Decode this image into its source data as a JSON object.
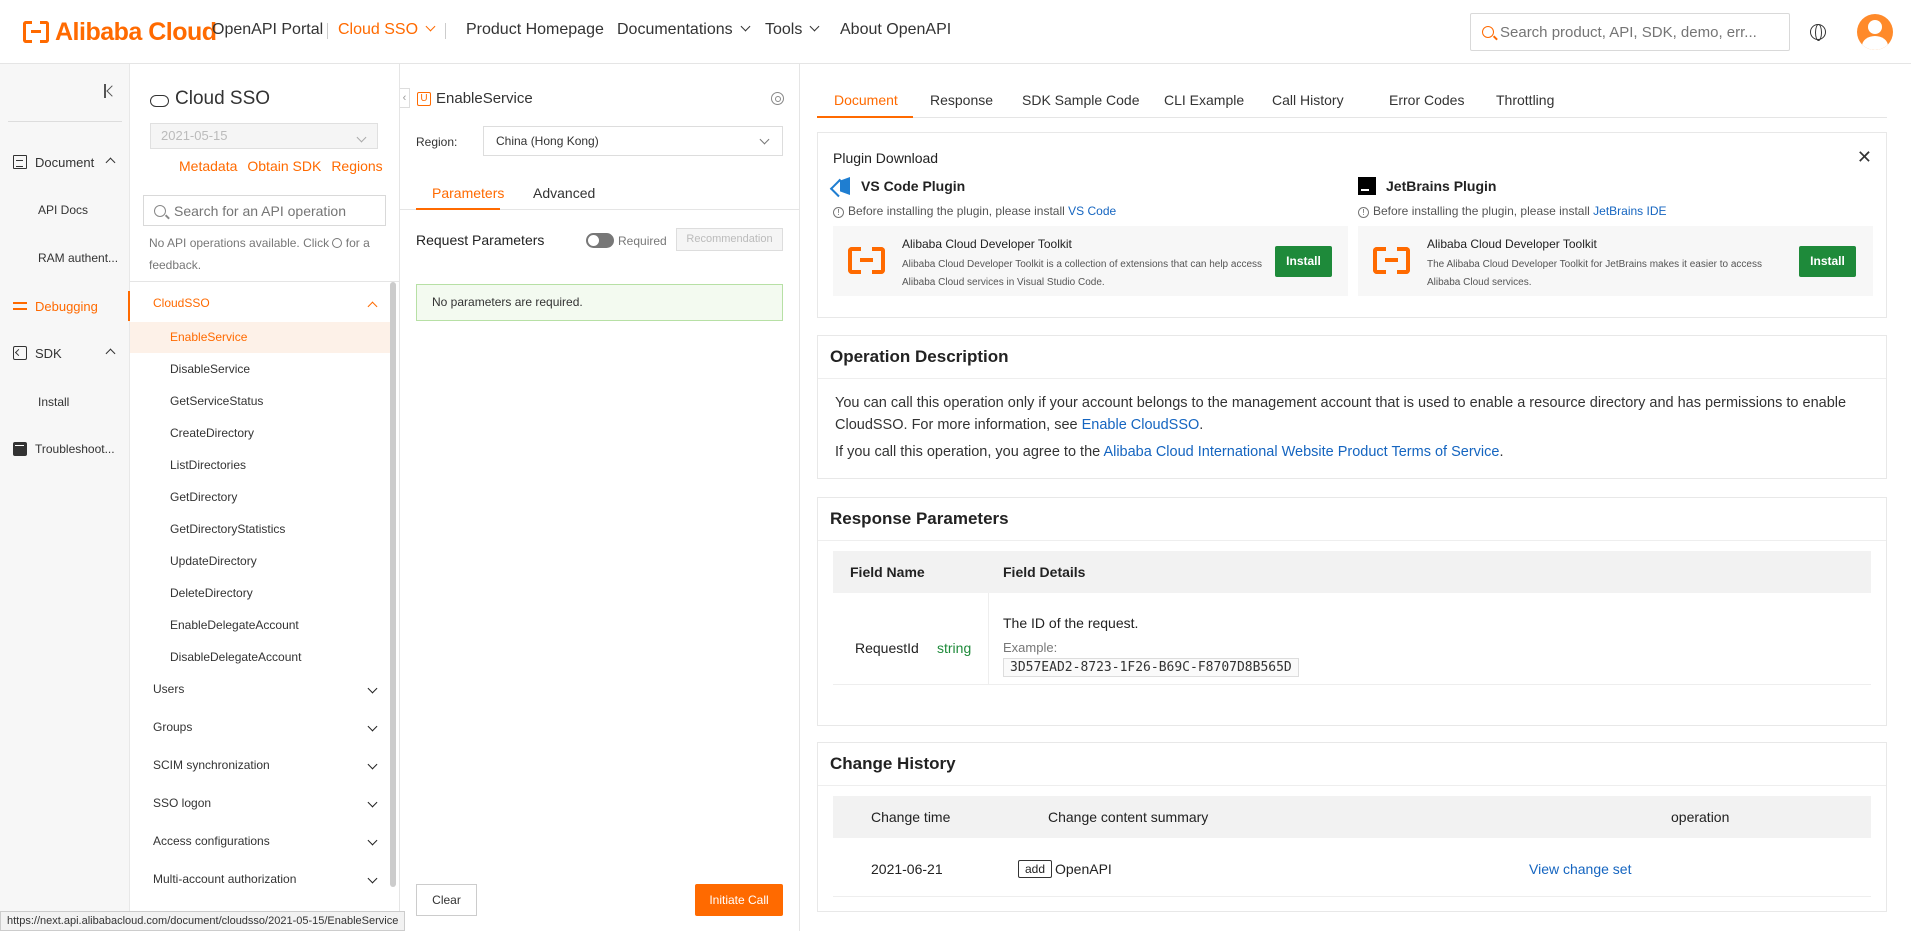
{
  "brand": {
    "name": "Alibaba Cloud",
    "color": "#ff6a00"
  },
  "topnav": {
    "portal": "OpenAPI Portal",
    "product": "Cloud SSO",
    "homepage": "Product Homepage",
    "docs": "Documentations",
    "tools": "Tools",
    "about": "About OpenAPI",
    "search_placeholder": "Search product, API, SDK, demo, err..."
  },
  "rail": {
    "document": "Document",
    "api_docs": "API Docs",
    "ram": "RAM authent...",
    "debugging": "Debugging",
    "sdk": "SDK",
    "install": "Install",
    "troubleshoot": "Troubleshoot..."
  },
  "apipanel": {
    "product": "Cloud SSO",
    "version": "2021-05-15",
    "links": [
      "Metadata",
      "Obtain SDK",
      "Regions"
    ],
    "search_placeholder": "Search for an API operation",
    "no_ops_1": "No API operations available. Click",
    "no_ops_2": "for a feedback.",
    "group_open": "CloudSSO",
    "operations": [
      "EnableService",
      "DisableService",
      "GetServiceStatus",
      "CreateDirectory",
      "ListDirectories",
      "GetDirectory",
      "GetDirectoryStatistics",
      "UpdateDirectory",
      "DeleteDirectory",
      "EnableDelegateAccount",
      "DisableDelegateAccount"
    ],
    "groups": [
      "Users",
      "Groups",
      "SCIM synchronization",
      "SSO logon",
      "Access configurations",
      "Multi-account authorization"
    ]
  },
  "debug": {
    "operation": "EnableService",
    "region_label": "Region:",
    "region": "China (Hong Kong)",
    "tab_params": "Parameters",
    "tab_advanced": "Advanced",
    "request_params": "Request Parameters",
    "required": "Required",
    "recommendation": "Recommendation",
    "no_params": "No parameters are required.",
    "clear": "Clear",
    "initiate": "Initiate Call"
  },
  "doc": {
    "tabs": [
      "Document",
      "Response",
      "SDK Sample Code",
      "CLI Example",
      "Call History",
      "Error Codes",
      "Throttling"
    ],
    "plugin": {
      "title": "Plugin Download",
      "vscode_name": "VS Code Plugin",
      "vscode_note": "Before installing the plugin, please install",
      "vscode_link": "VS Code",
      "jb_name": "JetBrains Plugin",
      "jb_note": "Before installing the plugin, please install",
      "jb_link": "JetBrains IDE",
      "toolkit": "Alibaba Cloud Developer Toolkit",
      "vscode_desc": "Alibaba Cloud Developer Toolkit is a collection of extensions that can help access Alibaba Cloud services in Visual Studio Code.",
      "jb_desc": "The Alibaba Cloud Developer Toolkit for JetBrains makes it easier to access Alibaba Cloud services.",
      "install": "Install"
    },
    "op_desc": {
      "title": "Operation Description",
      "p1": "You can call this operation only if your account belongs to the management account that is used to enable a resource directory and has permissions to enable CloudSSO. For more information, see",
      "p1_link": "Enable CloudSSO",
      "p2": "If you call this operation, you agree to the",
      "p2_link": "Alibaba Cloud International Website Product Terms of Service"
    },
    "response": {
      "title": "Response Parameters",
      "col1": "Field Name",
      "col2": "Field Details",
      "name": "RequestId",
      "type": "string",
      "desc": "The ID of the request.",
      "example_label": "Example:",
      "example": "3D57EAD2-8723-1F26-B69C-F8707D8B565D"
    },
    "history": {
      "title": "Change History",
      "col1": "Change time",
      "col2": "Change content summary",
      "col3": "operation",
      "time": "2021-06-21",
      "tag": "add",
      "summary": "OpenAPI",
      "link": "View change set"
    }
  },
  "status_url": "https://next.api.alibabacloud.com/document/cloudsso/2021-05-15/EnableService"
}
